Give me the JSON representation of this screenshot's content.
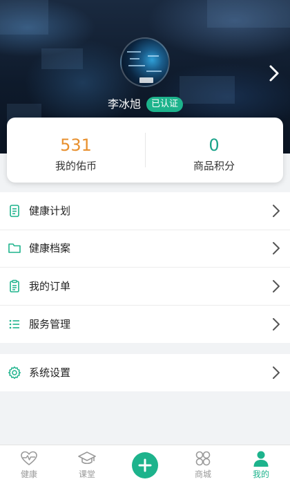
{
  "profile": {
    "username": "李冰旭",
    "verified_badge": "已认证"
  },
  "stats": {
    "coins_value": "531",
    "coins_label": "我的佑币",
    "points_value": "0",
    "points_label": "商品积分"
  },
  "menu": {
    "items": [
      {
        "label": "健康计划",
        "icon": "plan-icon"
      },
      {
        "label": "健康档案",
        "icon": "folder-icon"
      },
      {
        "label": "我的订单",
        "icon": "clipboard-icon"
      },
      {
        "label": "服务管理",
        "icon": "list-icon"
      },
      {
        "label": "系统设置",
        "icon": "gear-icon"
      }
    ]
  },
  "bottom_nav": {
    "items": [
      {
        "label": "健康",
        "icon": "heart-pulse-icon"
      },
      {
        "label": "课堂",
        "icon": "graduation-cap-icon"
      },
      {
        "label": "",
        "icon": "plus-icon"
      },
      {
        "label": "商城",
        "icon": "grid-icon"
      },
      {
        "label": "我的",
        "icon": "person-icon"
      }
    ],
    "active_index": 4
  },
  "colors": {
    "accent": "#1db38c",
    "coins": "#e8902e",
    "points": "#1ba38a"
  }
}
